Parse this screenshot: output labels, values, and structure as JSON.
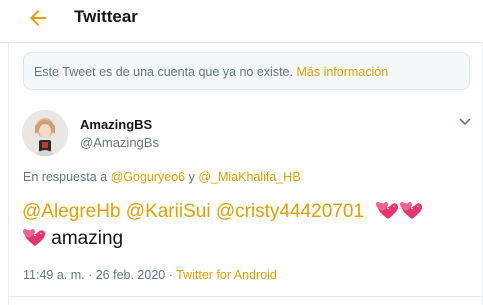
{
  "header": {
    "title": "Twittear",
    "back_icon": "arrow-left-icon"
  },
  "notice": {
    "text": "Este Tweet es de una cuenta que ya no existe.",
    "link": "Más información"
  },
  "tweet": {
    "author_name": "AmazingBS",
    "author_handle": "@AmazingBs",
    "reply_prefix": "En respuesta a",
    "reply_to_1": "@Goguryeo6",
    "reply_joiner": "y",
    "reply_to_2": "@_MiaKhalifa_HB",
    "mention_1": "@AlegreHb",
    "mention_2": "@KariiSui",
    "mention_3": "@cristy44420701",
    "body_word": "amazing",
    "emoji": "two-hearts-emoji",
    "timestamp": "11:49 a. m. · 26 feb. 2020",
    "meta_separator": "·",
    "source": "Twitter for Android"
  },
  "colors": {
    "accent": "#e0a100",
    "text": "#14171a",
    "secondary": "#657786",
    "border": "#e6ecf0",
    "notice_bg": "#f5f8fa"
  }
}
